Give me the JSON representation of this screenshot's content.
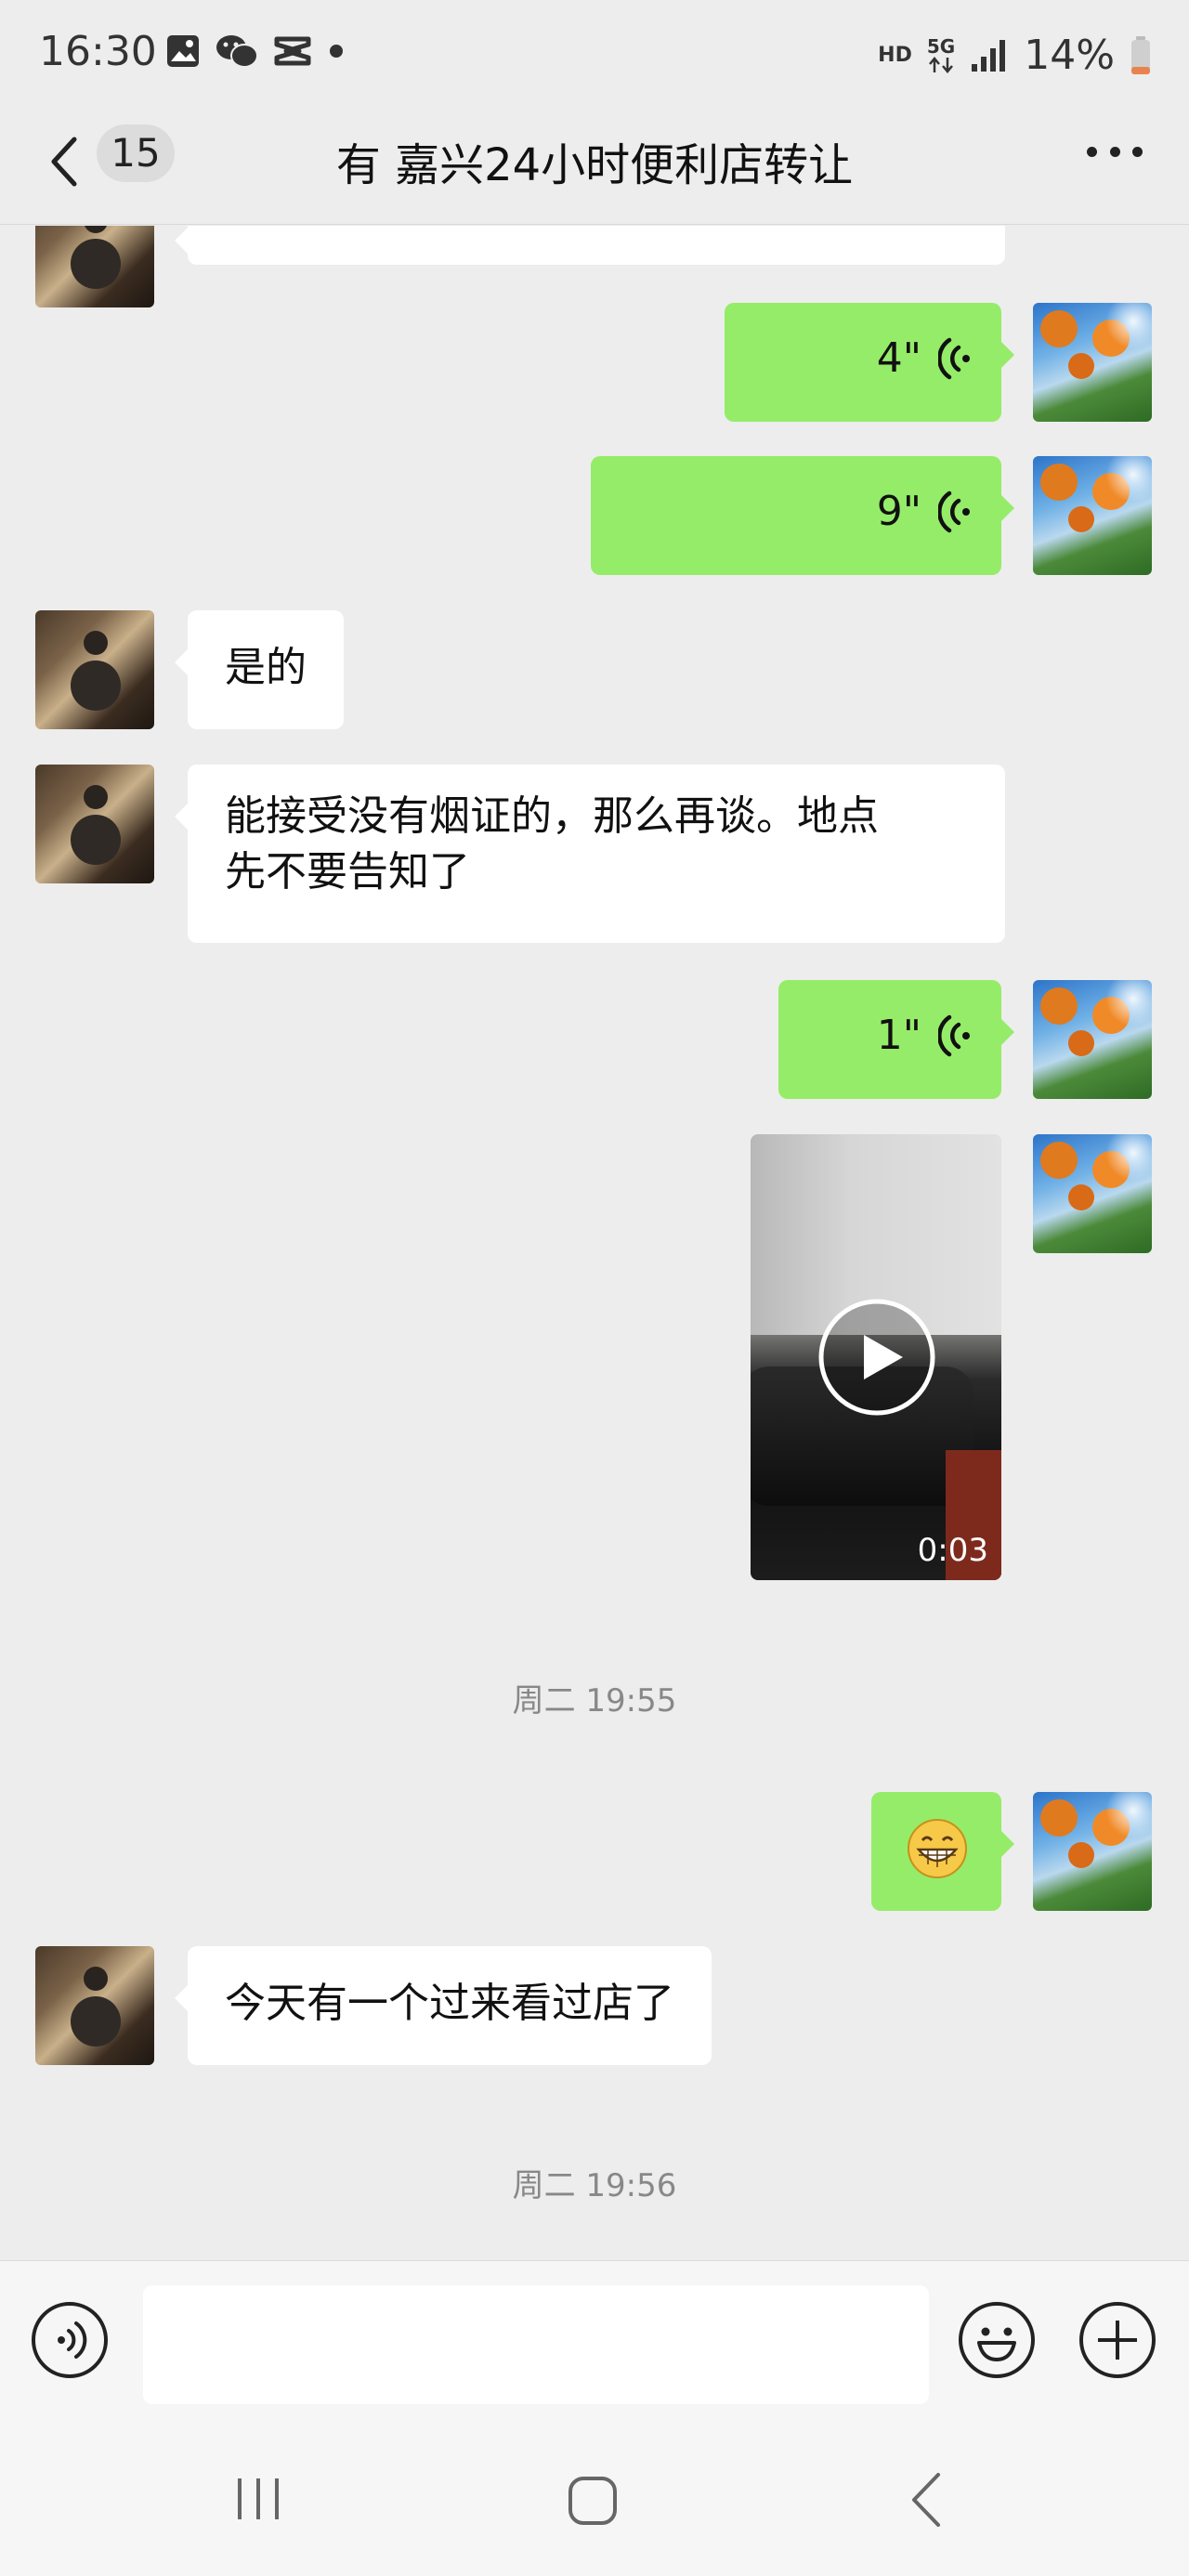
{
  "status_bar": {
    "time": "16:30",
    "hd_label": "HD",
    "network_label": "5G",
    "battery_percent": "14%"
  },
  "header": {
    "unread_count": "15",
    "title": "有 嘉兴24小时便利店转让",
    "more_icon": "more-dots-icon"
  },
  "messages": [
    {
      "type": "voice",
      "direction": "out",
      "duration": "4\""
    },
    {
      "type": "voice",
      "direction": "out",
      "duration": "9\""
    },
    {
      "type": "text",
      "direction": "in",
      "text": "是的"
    },
    {
      "type": "text",
      "direction": "in",
      "lines": [
        "能接受没有烟证的，那么再谈。地点",
        "先不要告知了"
      ]
    },
    {
      "type": "voice",
      "direction": "out",
      "duration": "1\""
    },
    {
      "type": "video",
      "direction": "out",
      "duration": "0:03"
    },
    {
      "type": "timestamp",
      "text": "周二 19:55"
    },
    {
      "type": "emoji",
      "direction": "out",
      "icon": "grinning-face-icon"
    },
    {
      "type": "text",
      "direction": "in",
      "text": "今天有一个过来看过店了"
    },
    {
      "type": "timestamp",
      "text": "周二 19:56"
    }
  ],
  "input_bar": {
    "value": "",
    "placeholder": ""
  },
  "colors": {
    "outgoing_bubble": "#95ec69",
    "incoming_bubble": "#ffffff",
    "background": "#ededed"
  }
}
